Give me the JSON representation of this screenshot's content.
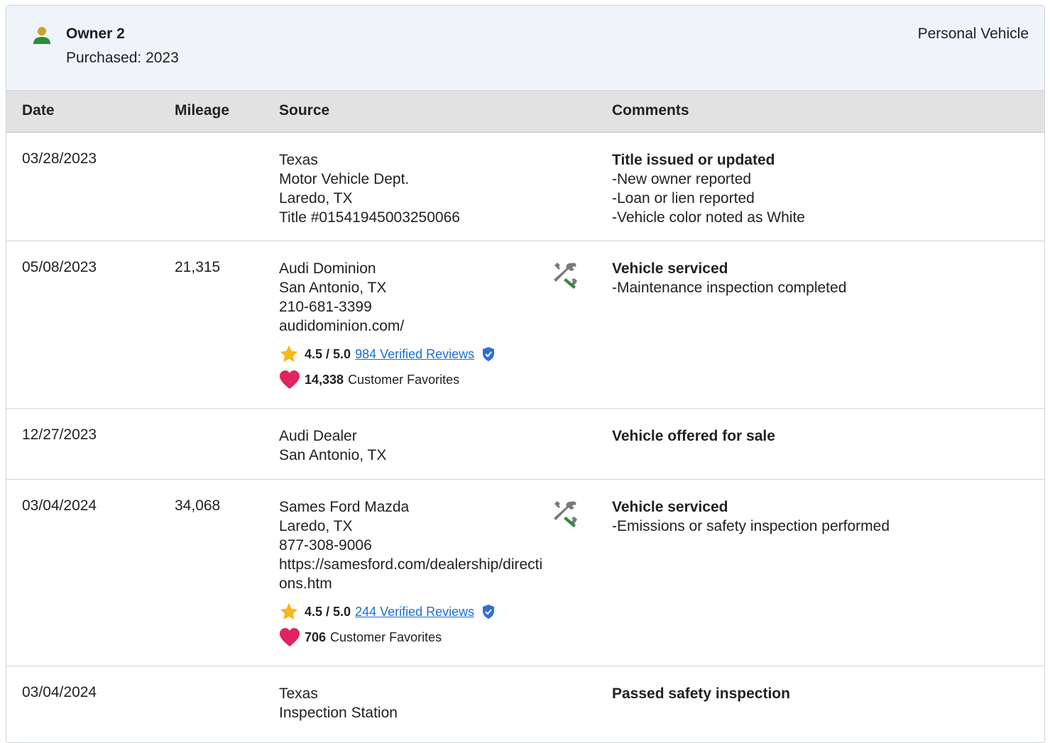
{
  "owner": {
    "name": "Owner 2",
    "purchased": "Purchased: 2023",
    "type": "Personal Vehicle"
  },
  "columns": {
    "date": "Date",
    "mileage": "Mileage",
    "source": "Source",
    "comments": "Comments"
  },
  "records": [
    {
      "date": "03/28/2023",
      "mileage": "",
      "source": [
        "Texas",
        "Motor Vehicle Dept.",
        "Laredo, TX",
        "Title #01541945003250066"
      ],
      "comment_title": "Title issued or updated",
      "comment_items": [
        "New owner reported",
        "Loan or lien reported",
        "Vehicle color noted as White"
      ]
    },
    {
      "date": "05/08/2023",
      "mileage": "21,315",
      "source": [
        "Audi Dominion",
        "San Antonio, TX",
        "210-681-3399",
        "audidominion.com/"
      ],
      "rating": "4.5 / 5.0",
      "reviews": "984 Verified Reviews",
      "favorites_count": "14,338",
      "favorites_label": "Customer Favorites",
      "comment_title": "Vehicle serviced",
      "comment_items": [
        "Maintenance inspection completed"
      ],
      "icon": "service-tools-icon"
    },
    {
      "date": "12/27/2023",
      "mileage": "",
      "source": [
        "Audi Dealer",
        "San Antonio, TX"
      ],
      "comment_title": "Vehicle offered for sale",
      "comment_items": []
    },
    {
      "date": "03/04/2024",
      "mileage": "34,068",
      "source": [
        "Sames Ford Mazda",
        "Laredo, TX",
        "877-308-9006",
        "https://samesford.com/dealership/directions.htm"
      ],
      "rating": "4.5 / 5.0",
      "reviews": "244 Verified Reviews",
      "favorites_count": "706",
      "favorites_label": "Customer Favorites",
      "comment_title": "Vehicle serviced",
      "comment_items": [
        "Emissions or safety inspection performed"
      ],
      "icon": "service-tools-icon"
    },
    {
      "date": "03/04/2024",
      "mileage": "",
      "source": [
        "Texas",
        "Inspection Station"
      ],
      "comment_title": "Passed safety inspection",
      "comment_items": []
    }
  ],
  "colors": {
    "header_bg": "#eef4fa",
    "table_head_bg": "#e2e2e2",
    "link": "#1a6fd6",
    "star": "#f6b81c",
    "heart": "#e0245e",
    "tool_green": "#2e8b3a",
    "tool_gray": "#7a7a7a"
  }
}
